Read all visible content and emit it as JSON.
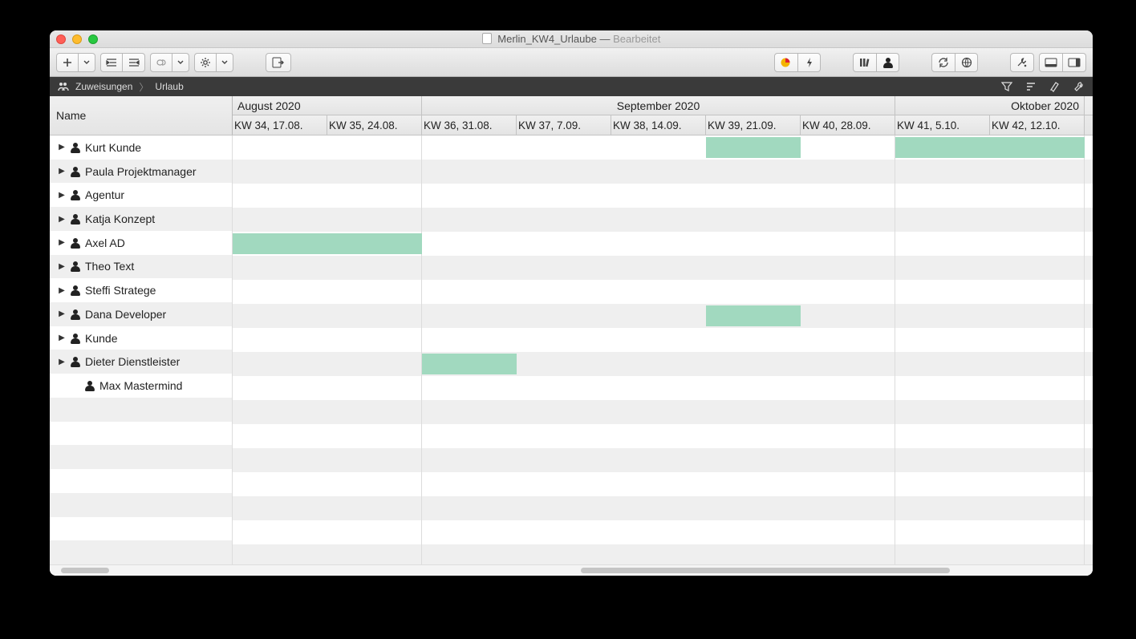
{
  "window": {
    "title": "Merlin_KW4_Urlaube",
    "status": "Bearbeitet"
  },
  "breadcrumb": {
    "item1": "Zuweisungen",
    "item2": "Urlaub"
  },
  "columns": {
    "name": "Name"
  },
  "months": [
    {
      "label": "August 2020",
      "span": 2
    },
    {
      "label": "September 2020",
      "span": 5
    },
    {
      "label": "Oktober 2020",
      "span": 2
    }
  ],
  "weeks": [
    "KW 34, 17.08.",
    "KW 35, 24.08.",
    "KW 36, 31.08.",
    "KW 37, 7.09.",
    "KW 38, 14.09.",
    "KW 39, 21.09.",
    "KW 40, 28.09.",
    "KW 41, 5.10.",
    "KW 42, 12.10."
  ],
  "resources": [
    {
      "name": "Kurt Kunde",
      "expandable": true,
      "bars": [
        [
          5,
          6
        ],
        [
          7,
          9
        ]
      ]
    },
    {
      "name": "Paula Projektmanager",
      "expandable": true,
      "bars": []
    },
    {
      "name": "Agentur",
      "expandable": true,
      "bars": []
    },
    {
      "name": "Katja Konzept",
      "expandable": true,
      "bars": []
    },
    {
      "name": "Axel AD",
      "expandable": true,
      "bars": [
        [
          0,
          2
        ]
      ]
    },
    {
      "name": "Theo Text",
      "expandable": true,
      "bars": []
    },
    {
      "name": "Steffi Stratege",
      "expandable": true,
      "bars": []
    },
    {
      "name": "Dana Developer",
      "expandable": true,
      "bars": [
        [
          5,
          6
        ]
      ]
    },
    {
      "name": "Kunde",
      "expandable": true,
      "bars": []
    },
    {
      "name": "Dieter Dienstleister",
      "expandable": true,
      "bars": [
        [
          2,
          3
        ]
      ]
    },
    {
      "name": "Max Mastermind",
      "expandable": false,
      "bars": []
    }
  ],
  "colors": {
    "bar": "#a1d9bf"
  }
}
